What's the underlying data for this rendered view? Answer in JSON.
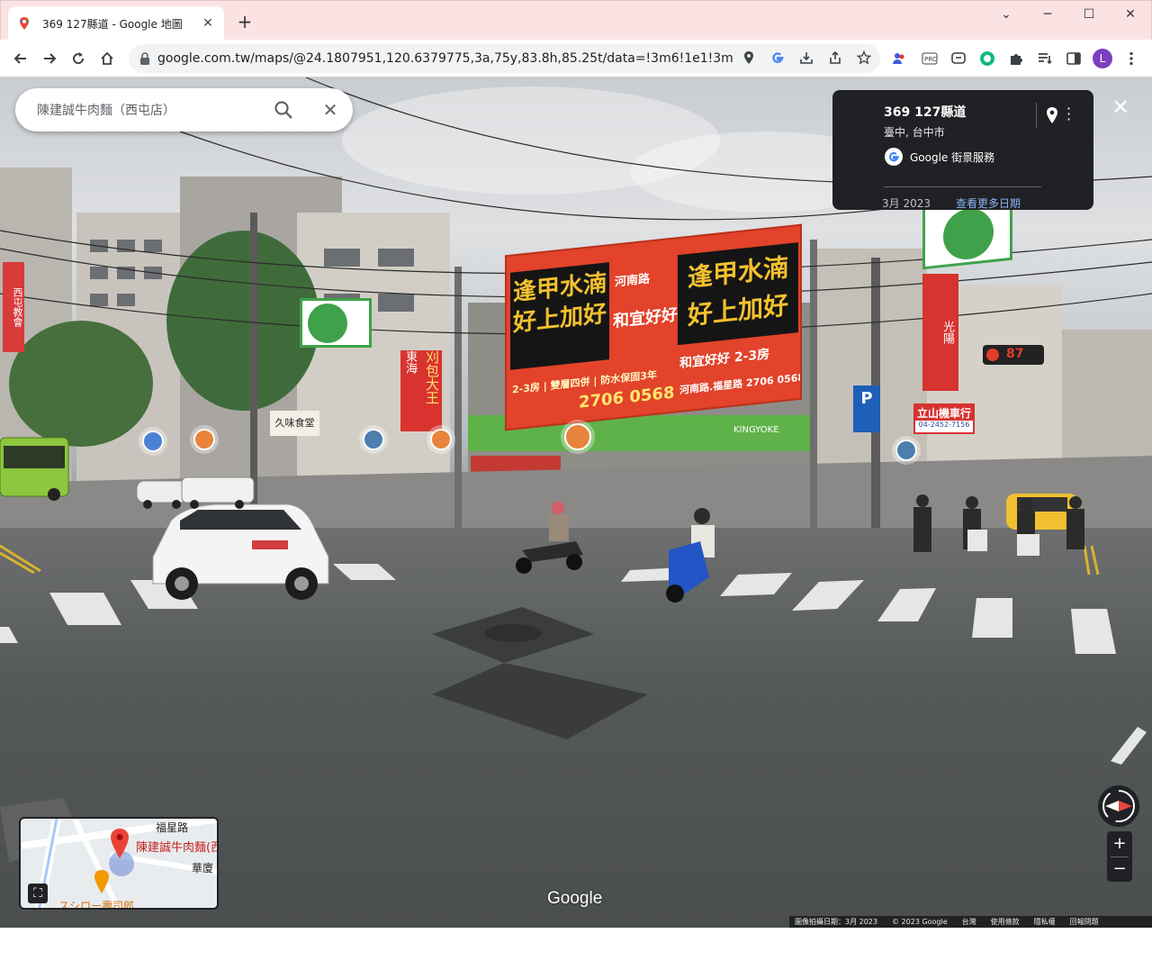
{
  "browser": {
    "tab_title": "369 127縣道 - Google 地圖",
    "tab_close": "✕",
    "new_tab": "+",
    "window_controls": {
      "minimize": "─",
      "maximize": "☐",
      "close": "✕",
      "tabsearch": "⌄"
    },
    "url": "google.com.tw/maps/@24.1807951,120.6379775,3a,75y,83.8h,85.25t/data=!3m6!1e1!3m4!1srl...",
    "profile_initial": "L",
    "icons": [
      "back-icon",
      "forward-icon",
      "reload-icon",
      "home-icon",
      "lock-icon",
      "location-icon",
      "google-icon",
      "install-icon",
      "share-icon",
      "bookmark-star-icon",
      "extension-icon",
      "reading-list-icon",
      "side-panel-icon",
      "menu-icon"
    ]
  },
  "search": {
    "query": "陳建誠牛肉麵（西屯店）",
    "clear_label": "✕"
  },
  "info_card": {
    "title": "369 127縣道",
    "subtitle": "臺中, 台中市",
    "service": "Google 街景服務",
    "date": "3月 2023",
    "more_dates": "查看更多日期"
  },
  "scene": {
    "billboard_line1": "逢甲水湳",
    "billboard_line2": "好上加好",
    "billboard_brand": "和宜好好",
    "billboard_road": "河南路",
    "billboard_rooms": "2-3房",
    "billboard_sub": "2-3房 | 雙層四併 | 防水保固3年",
    "billboard_phone": "2706 0568",
    "billboard_right_rooms": "和宜好好 2-3房",
    "billboard_right_addr": "河南路.福星路 2706 0568",
    "shop_sign": "KINGYOKE",
    "scooter_shop": "立山機車行",
    "scooter_phone": "04-2452-7156",
    "kymco": "光陽",
    "traffic_light": "87",
    "parking": "P",
    "left_sign": "西屯教會",
    "shop_small": "久味食堂",
    "side_sign_1": "東海",
    "side_sign_2": "刈包大王"
  },
  "minimap": {
    "road_1": "福星路",
    "place": "陳建誠牛肉麵(西",
    "road_2": "華廈",
    "road_3": "スシロー壽司郎"
  },
  "watermark": "Google",
  "footer": {
    "capture_date": "圖像拍攝日期：3月 2023",
    "copyright": "© 2023 Google",
    "region": "台灣",
    "terms": "使用條款",
    "privacy": "隱私權",
    "report": "回報問題"
  },
  "controls": {
    "zoom_in": "+",
    "zoom_out": "−"
  }
}
